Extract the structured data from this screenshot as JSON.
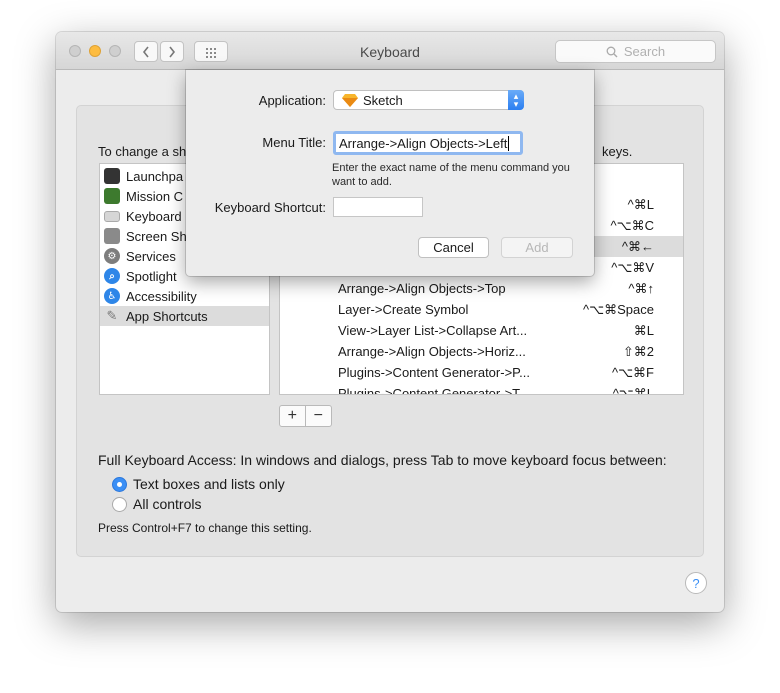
{
  "window": {
    "title": "Keyboard",
    "search_placeholder": "Search"
  },
  "panel": {
    "hint_left": "To change a sh",
    "hint_right": "keys."
  },
  "categories": [
    {
      "label": "Launchpa",
      "icon": "launchpad-icon",
      "color": "#333333"
    },
    {
      "label": "Mission C",
      "icon": "mission-control-icon",
      "color": "#3d7a2e"
    },
    {
      "label": "Keyboard",
      "icon": "keyboard-icon",
      "color": "#bdbdbd"
    },
    {
      "label": "Screen Sh",
      "icon": "camera-icon",
      "color": "#8a8a8a"
    },
    {
      "label": "Services",
      "icon": "gear-icon",
      "color": "#7d7d7d"
    },
    {
      "label": "Spotlight",
      "icon": "spotlight-icon",
      "color": "#2e86e8"
    },
    {
      "label": "Accessibility",
      "icon": "accessibility-icon",
      "color": "#2e86e8"
    },
    {
      "label": "App Shortcuts",
      "icon": "app-shortcuts-icon",
      "color": "#9a9a9a"
    }
  ],
  "shortcuts": {
    "visible_keys": [
      "^⌘L",
      "^⌥⌘C",
      "^⌘←",
      "^⌥⌘V"
    ],
    "rows": [
      {
        "name": "Arrange->Align Objects->Top",
        "key": "^⌘↑"
      },
      {
        "name": "Layer->Create Symbol",
        "key": "^⌥⌘Space"
      },
      {
        "name": "View->Layer List->Collapse Art...",
        "key": "⌘L"
      },
      {
        "name": "Arrange->Align Objects->Horiz...",
        "key": "⇧⌘2"
      },
      {
        "name": "Plugins->Content Generator->P...",
        "key": "^⌥⌘F"
      },
      {
        "name": "Plugins->Content Generator->T...",
        "key": "^⌥⌘L"
      }
    ]
  },
  "controls": {
    "plus": "+",
    "minus": "−"
  },
  "keyboard_access": {
    "label": "Full Keyboard Access: In windows and dialogs, press Tab to move keyboard focus between:",
    "option_text_boxes": "Text boxes and lists only",
    "option_all_controls": "All controls",
    "selected": "Text boxes and lists only",
    "note": "Press Control+F7 to change this setting."
  },
  "help": "?",
  "sheet": {
    "application_label": "Application:",
    "application_value": "Sketch",
    "menu_title_label": "Menu Title:",
    "menu_title_value": "Arrange->Align Objects->Left",
    "explain": "Enter the exact name of the menu command you want to add.",
    "shortcut_label": "Keyboard Shortcut:",
    "shortcut_value": "",
    "cancel": "Cancel",
    "add": "Add"
  },
  "colors": {
    "accent": "#3b8ff5",
    "selection": "#dcdcdc",
    "sketch_icon": "#f7b52c"
  }
}
